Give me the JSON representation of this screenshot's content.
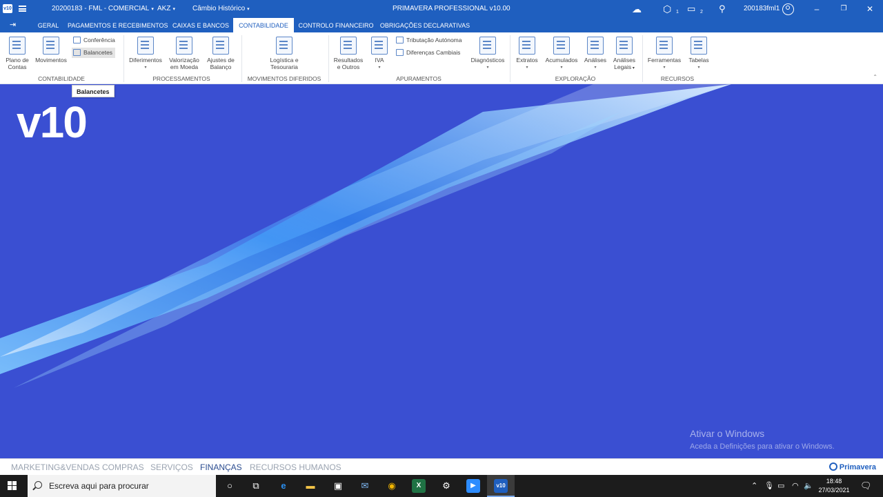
{
  "titlebar": {
    "company": "20200183 - FML - COMERCIAL",
    "currency": "AKZ",
    "exchange": "Câmbio Histórico",
    "app_title": "PRIMAVERA PROFESSIONAL v10.00",
    "user": "200183fml1",
    "notif_badge_1": "1",
    "notif_badge_2": "2"
  },
  "tabs": [
    {
      "label": "GERAL"
    },
    {
      "label": "PAGAMENTOS E RECEBIMENTOS"
    },
    {
      "label": "CAIXAS E BANCOS"
    },
    {
      "label": "CONTABILIDADE",
      "active": true
    },
    {
      "label": "CONTROLO FINANCEIRO"
    },
    {
      "label": "OBRIGAÇÕES DECLARATIVAS"
    }
  ],
  "ribbon": {
    "contabilidade": {
      "group": "CONTABILIDADE",
      "plano_l1": "Plano de",
      "plano_l2": "Contas",
      "movimentos": "Movimentos",
      "conferencia": "Conferência",
      "balancetes": "Balancetes"
    },
    "processamentos": {
      "group": "PROCESSAMENTOS",
      "diferimentos": "Diferimentos",
      "valorizacao_l1": "Valorização",
      "valorizacao_l2": "em Moeda",
      "ajustes_l1": "Ajustes de",
      "ajustes_l2": "Balanço"
    },
    "movimentos_diferidos": {
      "group": "MOVIMENTOS DIFERIDOS",
      "logistica_l1": "Logística e",
      "logistica_l2": "Tesouraria"
    },
    "apuramentos": {
      "group": "APURAMENTOS",
      "resultados_l1": "Resultados",
      "resultados_l2": "e Outros",
      "iva": "IVA",
      "tributacao": "Tributação Autónoma",
      "diferencas": "Diferenças Cambiais",
      "diagnosticos": "Diagnósticos"
    },
    "exploracao": {
      "group": "EXPLORAÇÃO",
      "extratos": "Extratos",
      "acumulados": "Acumulados",
      "analises": "Análises",
      "analises_legais_l1": "Análises",
      "analises_legais_l2": "Legais"
    },
    "recursos": {
      "group": "RECURSOS",
      "ferramentas": "Ferramentas",
      "tabelas": "Tabelas"
    }
  },
  "tooltip": "Balancetes",
  "workspace": {
    "logo": "v10",
    "activate_title": "Ativar o Windows",
    "activate_sub": "Aceda a Definições para ativar o Windows."
  },
  "modules": [
    {
      "label": "MARKETING&VENDAS"
    },
    {
      "label": "COMPRAS"
    },
    {
      "label": "SERVIÇOS"
    },
    {
      "label": "FINANÇAS",
      "active": true
    },
    {
      "label": "RECURSOS HUMANOS"
    }
  ],
  "brand": "Primavera",
  "taskbar": {
    "search_placeholder": "Escreva aqui para procurar",
    "time": "18:48",
    "date": "27/03/2021"
  },
  "colors": {
    "accent": "#1f5fbf",
    "workspace": "#3a4fd2",
    "taskbar": "#1c1c1c"
  }
}
